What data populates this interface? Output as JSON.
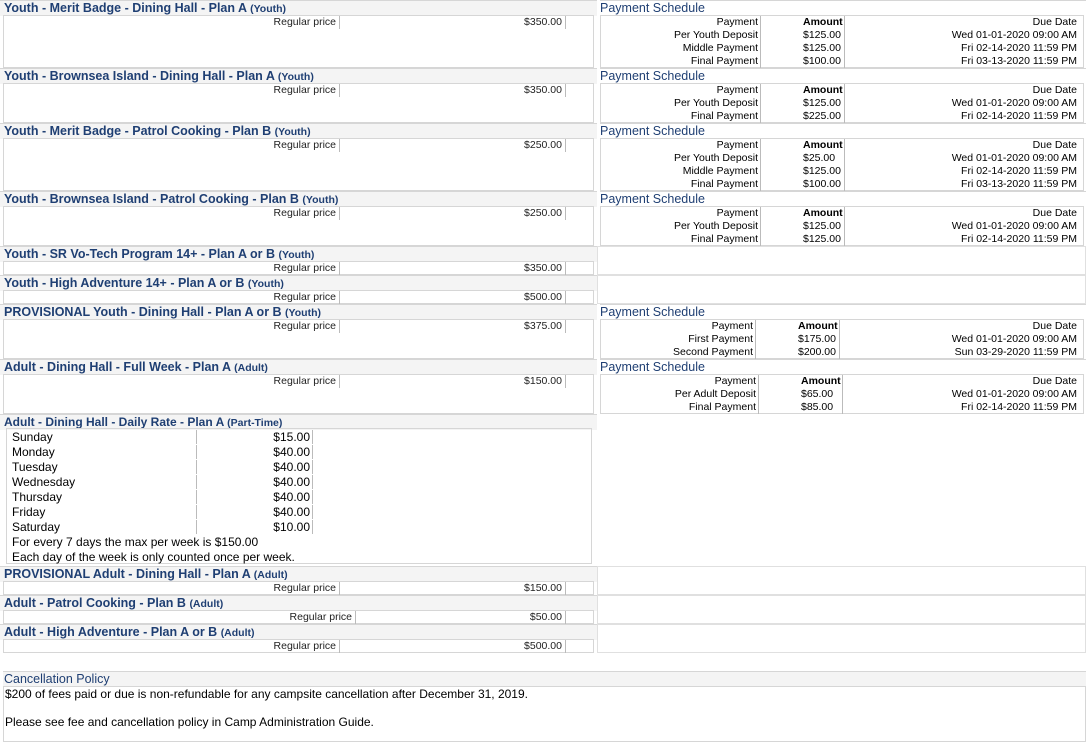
{
  "page_width": 1086,
  "colors": {
    "heading": "#1f3f73",
    "border": "#d6d6d6",
    "band": "#f4f4f4"
  },
  "regular_price_label": "Regular price",
  "plans": [
    {
      "title": "Youth - Merit Badge - Dining Hall - Plan A",
      "tag": "(Youth)",
      "price": "$350.00"
    },
    {
      "title": "Youth - Brownsea Island - Dining Hall - Plan A",
      "tag": "(Youth)",
      "price": "$350.00"
    },
    {
      "title": "Youth - Merit Badge - Patrol Cooking - Plan B",
      "tag": "(Youth)",
      "price": "$250.00"
    },
    {
      "title": "Youth - Brownsea Island - Patrol Cooking - Plan B",
      "tag": "(Youth)",
      "price": "$250.00"
    },
    {
      "title": "Youth - SR Vo-Tech Program 14+ - Plan A or B",
      "tag": "(Youth)",
      "price": "$350.00"
    },
    {
      "title": "Youth - High Adventure 14+ - Plan A or B",
      "tag": "(Youth)",
      "price": "$500.00"
    },
    {
      "title": "PROVISIONAL Youth - Dining Hall - Plan A or B",
      "tag": "(Youth)",
      "price": "$375.00"
    },
    {
      "title": "Adult - Dining Hall - Full Week - Plan A",
      "tag": "(Adult)",
      "price": "$150.00"
    },
    {
      "title": "Adult - Dining Hall - Daily Rate - Plan A",
      "tag": "(Part-Time)",
      "price": ""
    },
    {
      "title": "PROVISIONAL Adult - Dining Hall - Plan A",
      "tag": "(Adult)",
      "price": "$150.00"
    },
    {
      "title": "Adult - Patrol Cooking - Plan B",
      "tag": "(Adult)",
      "price": "$50.00"
    },
    {
      "title": "Adult - High Adventure - Plan A or B",
      "tag": "(Adult)",
      "price": "$500.00"
    }
  ],
  "schedule_title": "Payment Schedule",
  "schedule_headers": {
    "payment": "Payment",
    "amount": "Amount",
    "due": "Due Date"
  },
  "schedules": [
    {
      "rows": [
        {
          "payment": "Per Youth Deposit",
          "amount": "$125.00",
          "due": "Wed 01-01-2020 09:00 AM"
        },
        {
          "payment": "Middle Payment",
          "amount": "$125.00",
          "due": "Fri 02-14-2020 11:59 PM"
        },
        {
          "payment": "Final Payment",
          "amount": "$100.00",
          "due": "Fri 03-13-2020 11:59 PM"
        }
      ]
    },
    {
      "rows": [
        {
          "payment": "Per Youth Deposit",
          "amount": "$125.00",
          "due": "Wed 01-01-2020 09:00 AM"
        },
        {
          "payment": "Final Payment",
          "amount": "$225.00",
          "due": "Fri 02-14-2020 11:59 PM"
        }
      ]
    },
    {
      "rows": [
        {
          "payment": "Per Youth Deposit",
          "amount": "$25.00",
          "due": "Wed 01-01-2020 09:00 AM"
        },
        {
          "payment": "Middle Payment",
          "amount": "$125.00",
          "due": "Fri 02-14-2020 11:59 PM"
        },
        {
          "payment": "Final Payment",
          "amount": "$100.00",
          "due": "Fri 03-13-2020 11:59 PM"
        }
      ]
    },
    {
      "rows": [
        {
          "payment": "Per Youth Deposit",
          "amount": "$125.00",
          "due": "Wed 01-01-2020 09:00 AM"
        },
        {
          "payment": "Final Payment",
          "amount": "$125.00",
          "due": "Fri 02-14-2020 11:59 PM"
        }
      ]
    },
    {
      "rows": [
        {
          "payment": "First Payment",
          "amount": "$175.00",
          "due": "Wed 01-01-2020 09:00 AM"
        },
        {
          "payment": "Second Payment",
          "amount": "$200.00",
          "due": "Sun 03-29-2020 11:59 PM"
        }
      ]
    },
    {
      "rows": [
        {
          "payment": "Per Adult Deposit",
          "amount": "$65.00",
          "due": "Wed 01-01-2020 09:00 AM"
        },
        {
          "payment": "Final Payment",
          "amount": "$85.00",
          "due": "Fri 02-14-2020 11:59 PM"
        }
      ]
    }
  ],
  "daily_rates": [
    {
      "day": "Sunday",
      "price": "$15.00"
    },
    {
      "day": "Monday",
      "price": "$40.00"
    },
    {
      "day": "Tuesday",
      "price": "$40.00"
    },
    {
      "day": "Wednesday",
      "price": "$40.00"
    },
    {
      "day": "Thursday",
      "price": "$40.00"
    },
    {
      "day": "Friday",
      "price": "$40.00"
    },
    {
      "day": "Saturday",
      "price": "$10.00"
    }
  ],
  "daily_notes": [
    "For every 7 days the max per week is $150.00",
    "Each day of the week is only counted once per week."
  ],
  "cancellation": {
    "title": "Cancellation Policy",
    "line1": "$200 of fees paid or due is non-refundable for any campsite cancellation after December 31, 2019.",
    "line2": "Please see fee and cancellation policy in Camp Administration Guide."
  }
}
